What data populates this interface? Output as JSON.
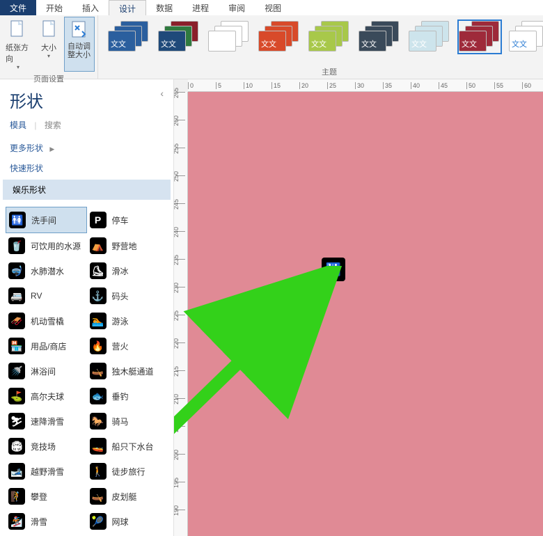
{
  "tabs": {
    "file": "文件",
    "home": "开始",
    "insert": "插入",
    "design": "设计",
    "data": "数据",
    "process": "进程",
    "review": "审阅",
    "view": "视图"
  },
  "ribbon": {
    "page_setup": {
      "orientation": "纸张方向",
      "size": "大小",
      "autofit": "自动调整大小",
      "group_label": "页面设置"
    },
    "themes": {
      "group_label": "主题",
      "items": [
        {
          "c1": "#2b5f9e",
          "c2": "#2b5f9e",
          "c3": "#2b5f9e",
          "txt": "文文"
        },
        {
          "c1": "#8a1f2a",
          "c2": "#2f7a3f",
          "c3": "#1f4a7a",
          "txt": "文文"
        },
        {
          "c1": "#ffffff",
          "c2": "#ffffff",
          "c3": "#ffffff",
          "txt": ""
        },
        {
          "c1": "#d84a2a",
          "c2": "#d84a2a",
          "c3": "#d84a2a",
          "txt": "文文"
        },
        {
          "c1": "#a8c84a",
          "c2": "#a8c84a",
          "c3": "#a8c84a",
          "txt": "文文"
        },
        {
          "c1": "#3a4a5a",
          "c2": "#3a4a5a",
          "c3": "#3a4a5a",
          "txt": "文文"
        },
        {
          "c1": "#cde4ec",
          "c2": "#cde4ec",
          "c3": "#cde4ec",
          "txt": "文文"
        },
        {
          "c1": "#9e2a3a",
          "c2": "#9e2a3a",
          "c3": "#9e2a3a",
          "txt": "文文",
          "selected": true
        },
        {
          "c1": "#ffffff",
          "c2": "#ffffff",
          "c3": "#ffffff",
          "txt": "文文",
          "txtcolor": "#2b7cd3"
        }
      ]
    }
  },
  "side": {
    "title": "形状",
    "stencils": "模具",
    "search": "搜索",
    "more_shapes": "更多形状",
    "quick_shapes": "快速形状",
    "category": "娱乐形状",
    "shapes": [
      {
        "label": "洗手间",
        "glyph": "🚻",
        "selected": true
      },
      {
        "label": "停车",
        "glyph": "P"
      },
      {
        "label": "可饮用的水源",
        "glyph": "🥤"
      },
      {
        "label": "野营地",
        "glyph": "⛺"
      },
      {
        "label": "水肺潜水",
        "glyph": "🤿"
      },
      {
        "label": "滑冰",
        "glyph": "⛸"
      },
      {
        "label": "RV",
        "glyph": "🚐"
      },
      {
        "label": "码头",
        "glyph": "⚓"
      },
      {
        "label": "机动雪橇",
        "glyph": "🛷"
      },
      {
        "label": "游泳",
        "glyph": "🏊"
      },
      {
        "label": "用品/商店",
        "glyph": "🏪"
      },
      {
        "label": "营火",
        "glyph": "🔥"
      },
      {
        "label": "淋浴间",
        "glyph": "🚿"
      },
      {
        "label": "独木艇通道",
        "glyph": "🛶"
      },
      {
        "label": "高尔夫球",
        "glyph": "⛳"
      },
      {
        "label": "垂钓",
        "glyph": "🐟"
      },
      {
        "label": "速降滑雪",
        "glyph": "⛷"
      },
      {
        "label": "骑马",
        "glyph": "🐎"
      },
      {
        "label": "竞技场",
        "glyph": "🏟"
      },
      {
        "label": "船只下水台",
        "glyph": "🚤"
      },
      {
        "label": "越野滑雪",
        "glyph": "🎿"
      },
      {
        "label": "徒步旅行",
        "glyph": "🚶"
      },
      {
        "label": "攀登",
        "glyph": "🧗"
      },
      {
        "label": "皮划艇",
        "glyph": "🛶"
      },
      {
        "label": "滑雪",
        "glyph": "🏂"
      },
      {
        "label": "网球",
        "glyph": "🎾"
      }
    ]
  },
  "canvas": {
    "ruler_h": [
      "0",
      "5",
      "10",
      "15",
      "20",
      "25",
      "30",
      "35",
      "40",
      "45",
      "50",
      "55",
      "60"
    ],
    "ruler_v": [
      "265",
      "260",
      "255",
      "250",
      "245",
      "240",
      "235",
      "230",
      "225",
      "220",
      "215",
      "210",
      "205",
      "200",
      "195",
      "190"
    ],
    "dropped_glyph": "🚻"
  }
}
